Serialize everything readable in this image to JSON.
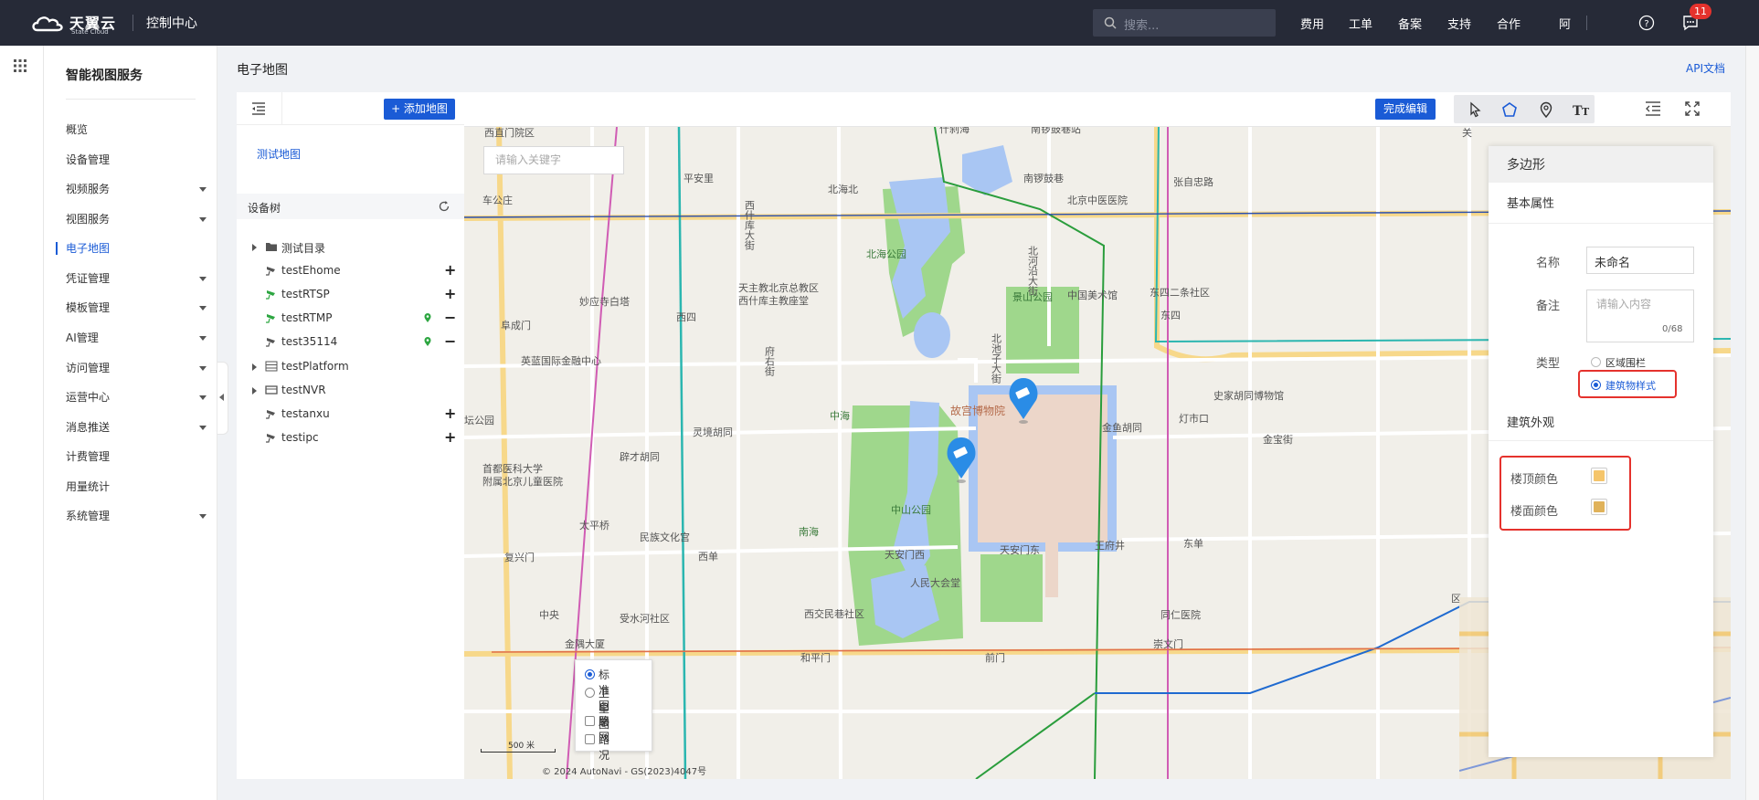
{
  "topbar": {
    "brand": "天翼云",
    "brand_sub": "State Cloud",
    "console": "控制中心",
    "search_placeholder": "搜索...",
    "nav": [
      "费用",
      "工单",
      "备案",
      "支持",
      "合作"
    ],
    "user": "阿",
    "message_badge": "11"
  },
  "sidenav": {
    "title": "智能视图服务",
    "items": [
      {
        "label": "概览",
        "has_caret": false
      },
      {
        "label": "设备管理",
        "has_caret": false
      },
      {
        "label": "视频服务",
        "has_caret": true
      },
      {
        "label": "视图服务",
        "has_caret": true
      },
      {
        "label": "电子地图",
        "has_caret": false,
        "active": true
      },
      {
        "label": "凭证管理",
        "has_caret": true
      },
      {
        "label": "模板管理",
        "has_caret": true
      },
      {
        "label": "AI管理",
        "has_caret": true
      },
      {
        "label": "访问管理",
        "has_caret": true
      },
      {
        "label": "运营中心",
        "has_caret": true
      },
      {
        "label": "消息推送",
        "has_caret": true
      },
      {
        "label": "计费管理",
        "has_caret": false
      },
      {
        "label": "用量统计",
        "has_caret": false
      },
      {
        "label": "系统管理",
        "has_caret": true
      }
    ]
  },
  "page": {
    "breadcrumb": "电子地图",
    "api_doc": "API文档"
  },
  "leftpanel": {
    "add_map": "+ 添加地图",
    "map_name": "测试地图",
    "tree_title": "设备树",
    "tree": [
      {
        "label": "测试目录",
        "type": "folder",
        "expand": true,
        "action": ""
      },
      {
        "label": "testEhome",
        "type": "camera",
        "action": "+",
        "pin": false
      },
      {
        "label": "testRTSP",
        "type": "camera-green",
        "action": "+",
        "pin": false
      },
      {
        "label": "testRTMP",
        "type": "camera-green",
        "action": "−",
        "pin": true
      },
      {
        "label": "test35114",
        "type": "camera",
        "action": "−",
        "pin": true
      },
      {
        "label": "testPlatform",
        "type": "platform",
        "expand": true,
        "action": ""
      },
      {
        "label": "testNVR",
        "type": "nvr",
        "expand": true,
        "action": ""
      },
      {
        "label": "testanxu",
        "type": "camera",
        "action": "+",
        "pin": false
      },
      {
        "label": "testipc",
        "type": "camera",
        "action": "+",
        "pin": false
      }
    ]
  },
  "map": {
    "done_edit": "完成编辑",
    "keyword_placeholder": "请输入关键字",
    "layers": {
      "standard": "标准图层",
      "satellite": "卫星图",
      "road_net": "路网",
      "traffic": "路况"
    },
    "scale": "500 米",
    "copyright": "© 2024 AutoNavi - GS(2023)4047号",
    "labels": [
      "西直门院区",
      "平安里",
      "北海北",
      "南锣鼓巷",
      "张自忠路",
      "北京中医医院",
      "车公庄",
      "北海公园",
      "景山公园",
      "北河沿大街",
      "中国美术馆",
      "东四",
      "东四二条社区",
      "妙应寺白塔",
      "西四",
      "天主教北京总教区",
      "西什库主教座堂",
      "阜成门",
      "英蓝国际金融中心",
      "府右街",
      "北池子大街",
      "中海",
      "故宫博物院",
      "金鱼胡同",
      "灯市口",
      "史家胡同博物馆",
      "灵境胡同",
      "坛公园",
      "首都医科大学",
      "附属北京儿童医院",
      "辟才胡同",
      "太平桥",
      "民族文化宫",
      "南海",
      "中山公园",
      "复兴门",
      "西单",
      "天安门西",
      "天安门东",
      "王府井",
      "东单",
      "人民大会堂",
      "西交民巷社区",
      "同仁医院",
      "崇文门",
      "前门",
      "和平门",
      "金隅大厦",
      "受水河社区",
      "中央",
      "西什库大街",
      "什刹海",
      "南锣鼓巷站",
      "金宝街",
      "区",
      "关"
    ]
  },
  "props": {
    "title": "多边形",
    "basic": "基本属性",
    "name_label": "名称",
    "name_value": "未命名",
    "note_label": "备注",
    "note_placeholder": "请输入内容",
    "note_count": "0/68",
    "type_label": "类型",
    "type_options": [
      "区域围栏",
      "建筑物样式"
    ],
    "type_selected": "建筑物样式",
    "appearance": "建筑外观",
    "roof_label": "楼顶颜色",
    "floor_label": "楼面颜色",
    "roof_color": "#f5c56b",
    "floor_color": "#e0b25a"
  },
  "colors": {
    "topbar": "#262a37",
    "accent": "#1a5bd6",
    "highlight": "#e5322d"
  }
}
